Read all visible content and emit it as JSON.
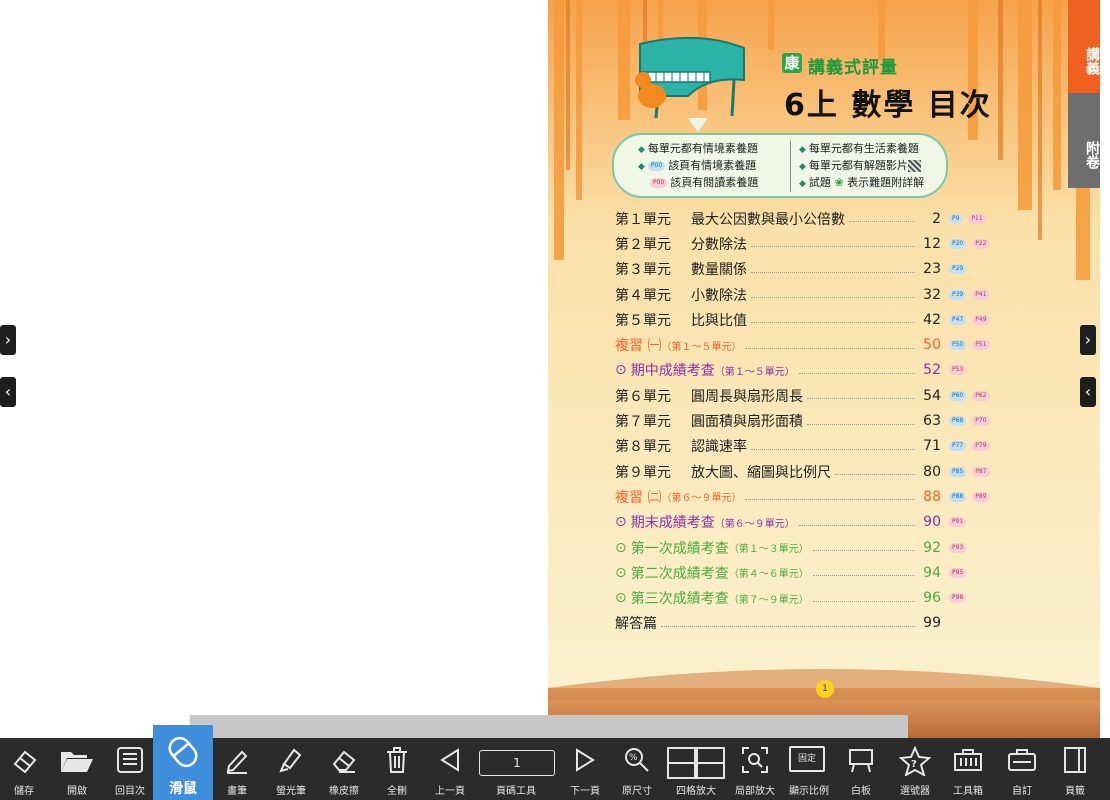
{
  "side_tabs": {
    "lecture": "講義",
    "appendix": "附卷"
  },
  "header": {
    "brand_mark": "康",
    "series": "講義式評量",
    "title": "6上 數學 目次"
  },
  "features": {
    "left": [
      "每單元都有情境素養題",
      "該頁有情境素養題",
      "該頁有閱讀素養題"
    ],
    "right": [
      "每單元都有生活素養題",
      "每單元都有解題影片",
      "試題",
      "表示難題附詳解"
    ],
    "tag_label": "P00"
  },
  "toc": [
    {
      "unit": "第１單元",
      "title": "最大公因數與最小公倍數",
      "sub": "",
      "page": "2",
      "tags": [
        "P9",
        "P11"
      ],
      "style": "normal"
    },
    {
      "unit": "第２單元",
      "title": "分數除法",
      "sub": "",
      "page": "12",
      "tags": [
        "P20",
        "P22"
      ],
      "style": "normal"
    },
    {
      "unit": "第３單元",
      "title": "數量關係",
      "sub": "",
      "page": "23",
      "tags": [
        "P29"
      ],
      "style": "normal"
    },
    {
      "unit": "第４單元",
      "title": "小數除法",
      "sub": "",
      "page": "32",
      "tags": [
        "P39",
        "P41"
      ],
      "style": "normal"
    },
    {
      "unit": "第５單元",
      "title": "比與比值",
      "sub": "",
      "page": "42",
      "tags": [
        "P47",
        "P49"
      ],
      "style": "normal"
    },
    {
      "unit": "",
      "title": "複習 ㈠",
      "sub": "（第１～５單元）",
      "page": "50",
      "tags": [
        "P50",
        "P51"
      ],
      "style": "orange"
    },
    {
      "unit": "",
      "title": "期中成績考查",
      "sub": "（第１～５單元）",
      "page": "52",
      "tags": [
        "P53"
      ],
      "style": "purple"
    },
    {
      "unit": "第６單元",
      "title": "圓周長與扇形周長",
      "sub": "",
      "page": "54",
      "tags": [
        "P60",
        "P62"
      ],
      "style": "normal"
    },
    {
      "unit": "第７單元",
      "title": "圓面積與扇形面積",
      "sub": "",
      "page": "63",
      "tags": [
        "P68",
        "P70"
      ],
      "style": "normal"
    },
    {
      "unit": "第８單元",
      "title": "認識速率",
      "sub": "",
      "page": "71",
      "tags": [
        "P77",
        "P79"
      ],
      "style": "normal"
    },
    {
      "unit": "第９單元",
      "title": "放大圖、縮圖與比例尺",
      "sub": "",
      "page": "80",
      "tags": [
        "P85",
        "P87"
      ],
      "style": "normal"
    },
    {
      "unit": "",
      "title": "複習 ㈡",
      "sub": "（第６～９單元）",
      "page": "88",
      "tags": [
        "P88",
        "P89"
      ],
      "style": "orange"
    },
    {
      "unit": "",
      "title": "期末成績考查",
      "sub": "（第６～９單元）",
      "page": "90",
      "tags": [
        "P91"
      ],
      "style": "purple"
    },
    {
      "unit": "",
      "title": "第一次成績考查",
      "sub": "（第１～３單元）",
      "page": "92",
      "tags": [
        "P93"
      ],
      "style": "green"
    },
    {
      "unit": "",
      "title": "第二次成績考查",
      "sub": "（第４～６單元）",
      "page": "94",
      "tags": [
        "P95"
      ],
      "style": "green"
    },
    {
      "unit": "",
      "title": "第三次成績考查",
      "sub": "（第７～９單元）",
      "page": "96",
      "tags": [
        "P98"
      ],
      "style": "green"
    },
    {
      "unit": "",
      "title": "解答篇",
      "sub": "",
      "page": "99",
      "tags": [],
      "style": "normal"
    }
  ],
  "page_number": "1",
  "toolbar": {
    "page_input": "1",
    "fixed_label": "固定",
    "items": [
      {
        "id": "save",
        "label": "儲存"
      },
      {
        "id": "open",
        "label": "開啟"
      },
      {
        "id": "toc",
        "label": "回目次"
      },
      {
        "id": "mouse",
        "label": "滑鼠"
      },
      {
        "id": "pen",
        "label": "畫筆"
      },
      {
        "id": "highlighter",
        "label": "螢光筆"
      },
      {
        "id": "eraser",
        "label": "橡皮擦"
      },
      {
        "id": "clear",
        "label": "全刪"
      },
      {
        "id": "prev",
        "label": "上一頁"
      },
      {
        "id": "page-tool",
        "label": "頁碼工具"
      },
      {
        "id": "next",
        "label": "下一頁"
      },
      {
        "id": "original",
        "label": "原尺寸"
      },
      {
        "id": "quad",
        "label": "四格放大"
      },
      {
        "id": "partial",
        "label": "局部放大"
      },
      {
        "id": "ratio",
        "label": "顯示比例"
      },
      {
        "id": "whiteboard",
        "label": "白板"
      },
      {
        "id": "picker",
        "label": "選號器"
      },
      {
        "id": "toolbox",
        "label": "工具箱"
      },
      {
        "id": "custom",
        "label": "自訂"
      },
      {
        "id": "margin",
        "label": "頁籤"
      }
    ]
  },
  "colors": {
    "toolbar_bg": "#2b2b2b",
    "active_tool": "#3f8edb",
    "tab_orange": "#f0601e",
    "tab_gray": "#6e6e6e"
  }
}
